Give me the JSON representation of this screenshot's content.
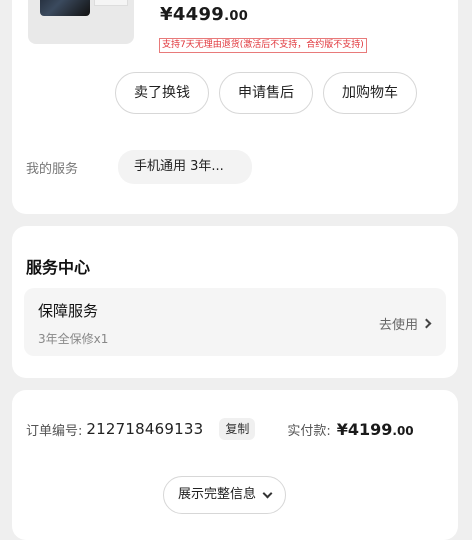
{
  "product": {
    "price_main": "¥4499",
    "price_dec": ".00",
    "return_policy": "支持7天无理由退货(激活后不支持，合约版不支持)"
  },
  "actions": {
    "sell": "卖了换钱",
    "after_sale": "申请售后",
    "add_cart": "加购物车"
  },
  "my_service": {
    "label": "我的服务",
    "value": "手机通用 3年..."
  },
  "service_center": {
    "title": "服务中心",
    "item_title": "保障服务",
    "item_sub": "3年全保修x1",
    "action": "去使用"
  },
  "order": {
    "no_label": "订单编号:",
    "no_value": "212718469133",
    "copy": "复制",
    "paid_label": "实付款:",
    "paid_main": "¥4199",
    "paid_dec": ".00",
    "expand": "展示完整信息"
  }
}
